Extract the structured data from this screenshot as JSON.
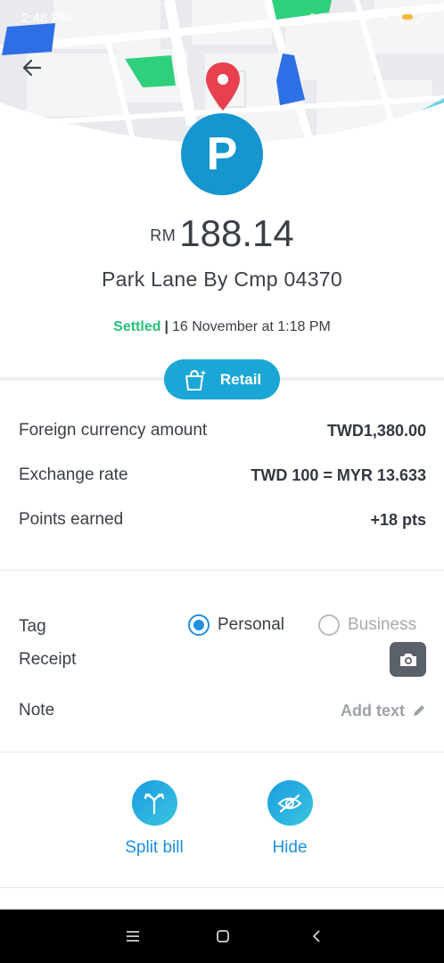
{
  "status_bar": {
    "time": "2:48 PM",
    "network_speed": "6.3KB/s",
    "battery_level": "8"
  },
  "merchant": {
    "logo_letter": "P",
    "name": "Park Lane By Cmp 04370"
  },
  "amount": {
    "currency": "RM",
    "value": "188.14"
  },
  "transaction": {
    "status": "Settled",
    "separator": "|",
    "date": "16 November at 1:18 PM"
  },
  "category": {
    "label": "Retail",
    "icon": "shopping-bag-icon"
  },
  "details": [
    {
      "label": "Foreign currency amount",
      "value": "TWD1,380.00"
    },
    {
      "label": "Exchange rate",
      "value": "TWD 100 = MYR 13.633"
    },
    {
      "label": "Points earned",
      "value": "+18 pts"
    }
  ],
  "tag": {
    "label": "Tag",
    "options": [
      "Personal",
      "Business"
    ],
    "selected": "Personal"
  },
  "receipt": {
    "label": "Receipt",
    "icon": "camera-icon"
  },
  "note": {
    "label": "Note",
    "placeholder": "Add text",
    "icon": "pencil-icon"
  },
  "actions": [
    {
      "label": "Split bill",
      "icon": "split-icon"
    },
    {
      "label": "Hide",
      "icon": "eye-off-icon"
    }
  ],
  "colors": {
    "accent": "#1f8fe0",
    "logo_bg": "#1596cf",
    "pill_bg": "#1aa7d6",
    "settled": "#27c07a",
    "map_pin": "#e8404e",
    "map_green": "#2fd07c",
    "map_blue": "#2f6fe6"
  }
}
